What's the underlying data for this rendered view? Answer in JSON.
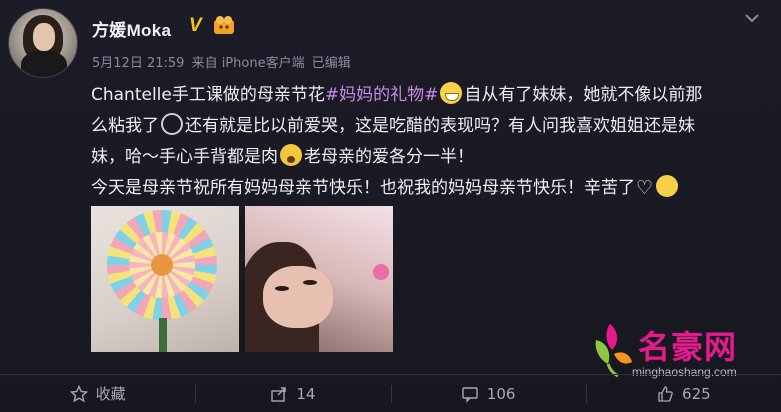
{
  "user": {
    "name": "方媛Moka",
    "verified_mark": "V"
  },
  "meta": {
    "date": "5月12日 21:59",
    "via": "来自 iPhone客户端",
    "edited": "已编辑"
  },
  "content": {
    "line1_prefix": "Chantelle手工课做的母亲节花",
    "hashtag": "#妈妈的礼物#",
    "line1_suffix": "自从有了妹妹，她就不像以前那",
    "line2_a": "么粘我了",
    "line2_b": "还有就是比以前爱哭，这是吃醋的表现吗？有人问我喜欢姐姐还是妹",
    "line3_a": "妹，哈～手心手背都是肉",
    "line3_b": "老母亲的爱各分一半！",
    "line4": "今天是母亲节祝所有妈妈母亲节快乐！也祝我的妈妈母亲节快乐！辛苦了"
  },
  "watermark": {
    "title": "名豪网",
    "url": "minghaoshang.com"
  },
  "actions": [
    {
      "label": "收藏",
      "icon": "star-icon"
    },
    {
      "label": "14",
      "icon": "share-icon"
    },
    {
      "label": "106",
      "icon": "comment-icon"
    },
    {
      "label": "625",
      "icon": "like-icon"
    }
  ],
  "colors": {
    "hashtag": "#c98be8",
    "verified": "#f6c21c",
    "watermark": "#e6198d"
  }
}
